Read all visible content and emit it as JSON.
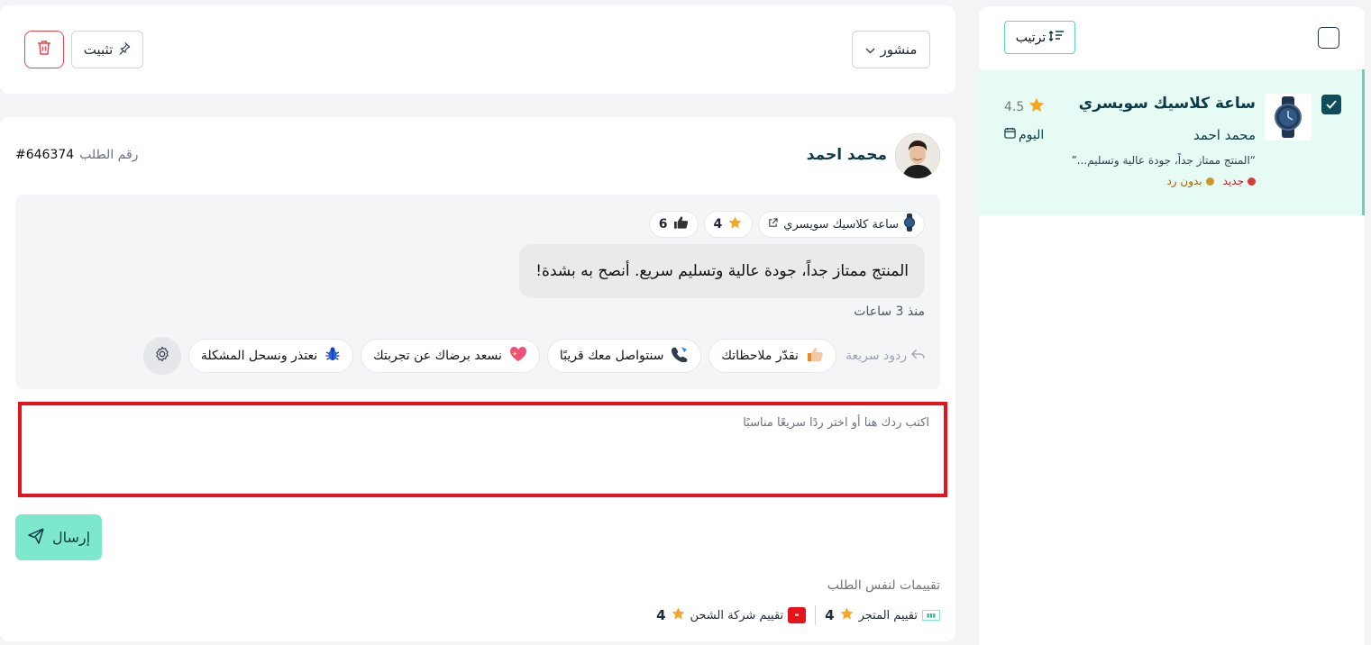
{
  "toolbar": {
    "status_label": "منشور",
    "pin_label": "تثبيت"
  },
  "list": {
    "sort_label": "ترتيب",
    "items": [
      {
        "product_name": "ساعة كلاسيك سويسري",
        "rating": "4.5",
        "author": "محمد احمد",
        "date": "اليوم",
        "snippet": "“المنتج ممتاز جداً، جودة عالية وتسليم...”",
        "badge_new": "جديد",
        "badge_unreplied": "بدون رد",
        "badge_new_color": "#d63a3a",
        "badge_unreplied_color": "#c9962b",
        "selected": true
      }
    ]
  },
  "review": {
    "reviewer_name": "محمد احمد",
    "order_label": "رقم الطلب",
    "order_number": "#646374",
    "product_chip": "ساعة كلاسيك سويسري",
    "rating": "4",
    "likes": "6",
    "text": "المنتج ممتاز جداً، جودة عالية وتسليم سريع. أنصح به بشدة!",
    "time_ago": "منذ 3 ساعات"
  },
  "quick_replies": {
    "label": "ردود سريعة",
    "items": [
      {
        "label": "نقدّر ملاحظاتك",
        "icon": "thumbs-up-icon"
      },
      {
        "label": "سنتواصل معك قريبًا",
        "icon": "telephone-icon"
      },
      {
        "label": "نسعد برضاك عن تجربتك",
        "icon": "sparkling-heart-icon"
      },
      {
        "label": "نعتذر ونسحل المشكلة",
        "icon": "bug-icon"
      }
    ]
  },
  "reply": {
    "placeholder": "اكتب ردك هنا أو اختر ردًا سريعًا مناسبًا",
    "value": "",
    "send_label": "إرسال"
  },
  "related": {
    "title": "تقييمات لنفس الطلب",
    "store_label": "تقييم المتجر",
    "store_rating": "4",
    "shipping_label": "تقييم شركة الشحن",
    "shipping_rating": "4"
  },
  "colors": {
    "accent": "#7ee8cc",
    "primary_dark": "#0b3b47",
    "highlight_border": "#e3141b",
    "star": "#f5a623"
  }
}
